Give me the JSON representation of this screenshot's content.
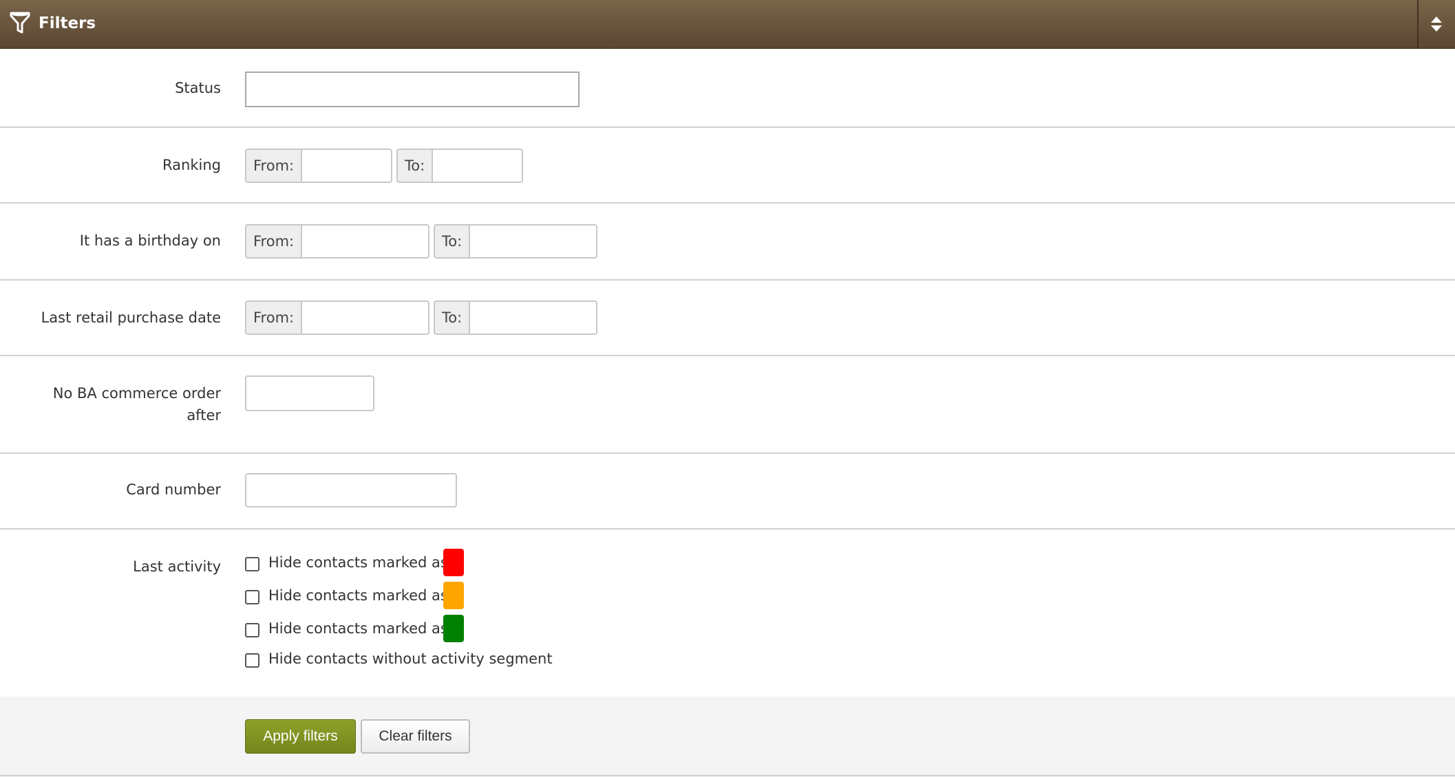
{
  "header": {
    "title": "Filters",
    "icons": {
      "filter": "filter-icon",
      "toggle": "sort-toggle-icon"
    }
  },
  "fields": {
    "status": {
      "label": "Status",
      "value": ""
    },
    "ranking": {
      "label": "Ranking",
      "from_label": "From:",
      "to_label": "To:",
      "from_value": "",
      "to_value": ""
    },
    "birthday": {
      "label": "It has a birthday on",
      "from_label": "From:",
      "to_label": "To:",
      "from_value": "",
      "to_value": ""
    },
    "last_retail": {
      "label": "Last retail purchase date",
      "from_label": "From:",
      "to_label": "To:",
      "from_value": "",
      "to_value": ""
    },
    "no_ba_order": {
      "label_line1": "No BA commerce order",
      "label_line2": "after",
      "value": ""
    },
    "card_number": {
      "label": "Card number",
      "value": ""
    }
  },
  "last_activity": {
    "label": "Last activity",
    "options": [
      {
        "text": "Hide contacts marked as",
        "swatch_color": "#ff0000",
        "checked": false
      },
      {
        "text": "Hide contacts marked as",
        "swatch_color": "#ffa500",
        "checked": false
      },
      {
        "text": "Hide contacts marked as",
        "swatch_color": "#008000",
        "checked": false
      },
      {
        "text": "Hide contacts without activity segment",
        "swatch_color": "",
        "checked": false
      }
    ]
  },
  "buttons": {
    "apply": "Apply filters",
    "clear": "Clear filters"
  },
  "colors": {
    "header_bg": "#6b5640",
    "apply_bg": "#82931f"
  }
}
